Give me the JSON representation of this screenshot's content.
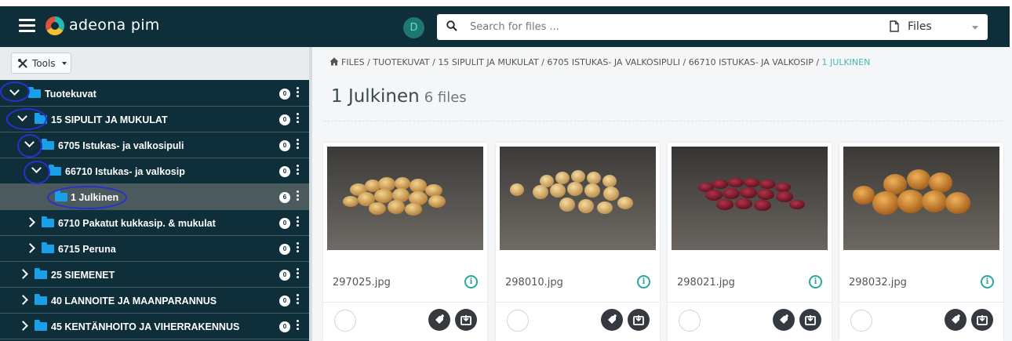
{
  "app": {
    "brand": "adeona pim"
  },
  "header": {
    "scope_chip": "D",
    "search": {
      "placeholder": "Search for files ...",
      "value": ""
    },
    "type_select": {
      "selected": "Files"
    }
  },
  "sidebar": {
    "tools_label": "Tools",
    "tree": [
      {
        "label": "Tuotekuvat",
        "count": "0",
        "expanded": true,
        "level": 0
      },
      {
        "label": "15 SIPULIT JA MUKULAT",
        "count": "0",
        "expanded": true,
        "level": 0
      },
      {
        "label": "6705 Istukas- ja valkosipuli",
        "count": "0",
        "expanded": true,
        "level": 1
      },
      {
        "label": "66710 Istukas- ja valkosip",
        "count": "0",
        "expanded": true,
        "level": 2
      },
      {
        "label": "1 Julkinen",
        "count": "6",
        "expanded": false,
        "level": 3,
        "selected": true
      },
      {
        "label": "6710 Pakatut kukkasip. & mukulat",
        "count": "0",
        "expanded": false,
        "level": 1
      },
      {
        "label": "6715 Peruna",
        "count": "0",
        "expanded": false,
        "level": 1
      },
      {
        "label": "25 SIEMENET",
        "count": "0",
        "expanded": false,
        "level": 0
      },
      {
        "label": "40 LANNOITE JA MAANPARANNUS",
        "count": "0",
        "expanded": false,
        "level": 0
      },
      {
        "label": "45 KENTÄNHOITO JA VIHERRAKENNUS",
        "count": "0",
        "expanded": false,
        "level": 0
      }
    ]
  },
  "main": {
    "breadcrumb": [
      "FILES",
      "TUOTEKUVAT",
      "15 SIPULIT JA MUKULAT",
      "6705 ISTUKAS- JA VALKOSIPULI",
      "66710 ISTUKAS- JA VALKOSIP",
      "1 JULKINEN"
    ],
    "breadcrumb_sep": " / ",
    "title": "1 Julkinen",
    "file_count": "6 files",
    "files": [
      {
        "name": "297025.jpg",
        "onion": "yellow-small"
      },
      {
        "name": "298010.jpg",
        "onion": "yellow-small"
      },
      {
        "name": "298021.jpg",
        "onion": "red"
      },
      {
        "name": "298032.jpg",
        "onion": "yellow-large"
      }
    ]
  },
  "colors": {
    "topbar": "#0e2f3a",
    "accent": "#45b9b0",
    "folder": "#1aa0e8"
  }
}
